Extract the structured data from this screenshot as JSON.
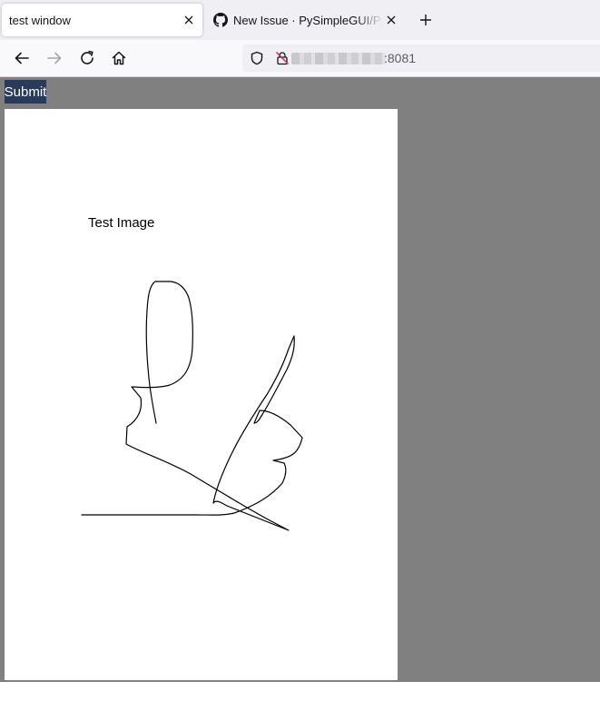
{
  "browser": {
    "tabs": [
      {
        "title": "test window",
        "active": true
      },
      {
        "title": "New Issue · PySimpleGUI/PySimpleGUI",
        "active": false,
        "favicon": "github-icon"
      }
    ],
    "url_suffix": ":8081"
  },
  "app": {
    "submit_label": "Submit",
    "graph_text": "Test Image",
    "background_color": "#808080",
    "button_color": "#283b5b"
  }
}
